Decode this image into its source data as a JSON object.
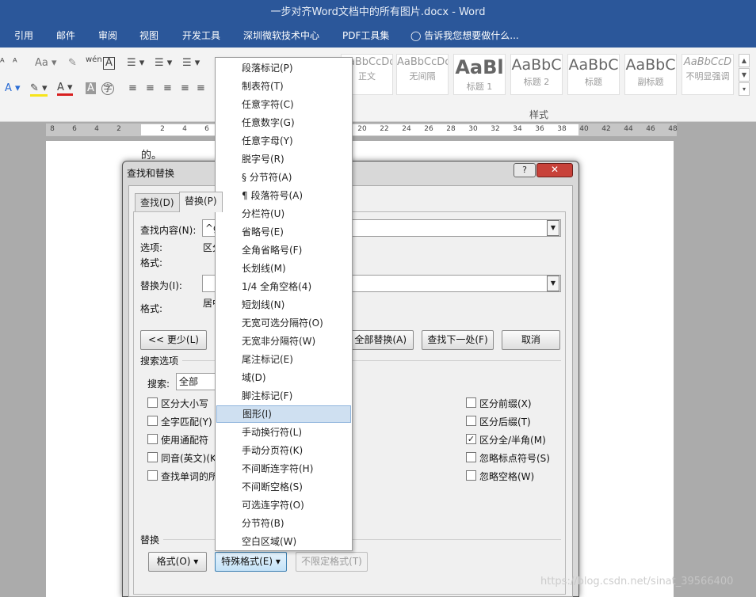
{
  "window": {
    "title": "一步对齐Word文档中的所有图片.docx - Word"
  },
  "ribbon": {
    "tabs": [
      "引用",
      "邮件",
      "审阅",
      "视图",
      "开发工具",
      "深圳微软技术中心",
      "PDF工具集"
    ],
    "tell_me": "告诉我您想要做什么...",
    "styles_group_label": "样式",
    "styles": [
      {
        "sample": "AaBbCcDc",
        "name": "正文"
      },
      {
        "sample": "AaBbCcDc",
        "name": "无间隔"
      },
      {
        "sample": "AaBl",
        "name": "标题 1"
      },
      {
        "sample": "AaBbC",
        "name": "标题 2"
      },
      {
        "sample": "AaBbC",
        "name": "标题"
      },
      {
        "sample": "AaBbC",
        "name": "副标题"
      },
      {
        "sample": "AaBbCcD",
        "name": "不明显强调"
      }
    ]
  },
  "ruler": {
    "ticks": [
      "8",
      "6",
      "4",
      "2",
      "2",
      "4",
      "6",
      "20",
      "22",
      "24",
      "26",
      "28",
      "30",
      "32",
      "34",
      "36",
      "38",
      "40",
      "42",
      "44",
      "46",
      "48"
    ]
  },
  "document": {
    "text": "的。"
  },
  "dialog": {
    "title": "查找和替换",
    "help": "?",
    "close": "✕",
    "tabs": {
      "find": "查找(D)",
      "replace": "替换(P)"
    },
    "find_label": "查找内容(N):",
    "find_value": "^g",
    "options_label": "选项:",
    "options_value": "区分",
    "format_label": "格式:",
    "replace_label": "替换为(I):",
    "replace_value": "",
    "replace_format_label": "格式:",
    "replace_format_value": "居中",
    "less_button": "<< 更少(L)",
    "replace_all_button": "全部替换(A)",
    "find_next_button": "查找下一处(F)",
    "cancel_button": "取消",
    "search_options_header": "搜索选项",
    "search_label": "搜索:",
    "search_value": "全部",
    "checkboxes_left": [
      {
        "label": "区分大小写",
        "checked": false
      },
      {
        "label": "全字匹配(Y)",
        "checked": false
      },
      {
        "label": "使用通配符",
        "checked": false
      },
      {
        "label": "同音(英文)(K)",
        "checked": false
      },
      {
        "label": "查找单词的所",
        "checked": false
      }
    ],
    "checkboxes_right": [
      {
        "label": "区分前缀(X)",
        "checked": false
      },
      {
        "label": "区分后缀(T)",
        "checked": false
      },
      {
        "label": "区分全/半角(M)",
        "checked": true
      },
      {
        "label": "忽略标点符号(S)",
        "checked": false
      },
      {
        "label": "忽略空格(W)",
        "checked": false
      }
    ],
    "replace_header": "替换",
    "format_button": "格式(O)",
    "special_button": "特殊格式(E)",
    "no_format_button": "不限定格式(T)"
  },
  "special_menu": {
    "items": [
      "段落标记(P)",
      "制表符(T)",
      "任意字符(C)",
      "任意数字(G)",
      "任意字母(Y)",
      "脱字号(R)",
      "§ 分节符(A)",
      "¶ 段落符号(A)",
      "分栏符(U)",
      "省略号(E)",
      "全角省略号(F)",
      "长划线(M)",
      "1/4 全角空格(4)",
      "短划线(N)",
      "无宽可选分隔符(O)",
      "无宽非分隔符(W)",
      "尾注标记(E)",
      "域(D)",
      "脚注标记(F)",
      "图形(I)",
      "手动换行符(L)",
      "手动分页符(K)",
      "不间断连字符(H)",
      "不间断空格(S)",
      "可选连字符(O)",
      "分节符(B)",
      "空白区域(W)"
    ],
    "selected_index": 19
  },
  "watermark": "https://blog.csdn.net/sinat_39566400",
  "colors": {
    "title_bar": "#2b579a",
    "close_button": "#c8423a",
    "menu_selection": "#cfe0f1"
  }
}
